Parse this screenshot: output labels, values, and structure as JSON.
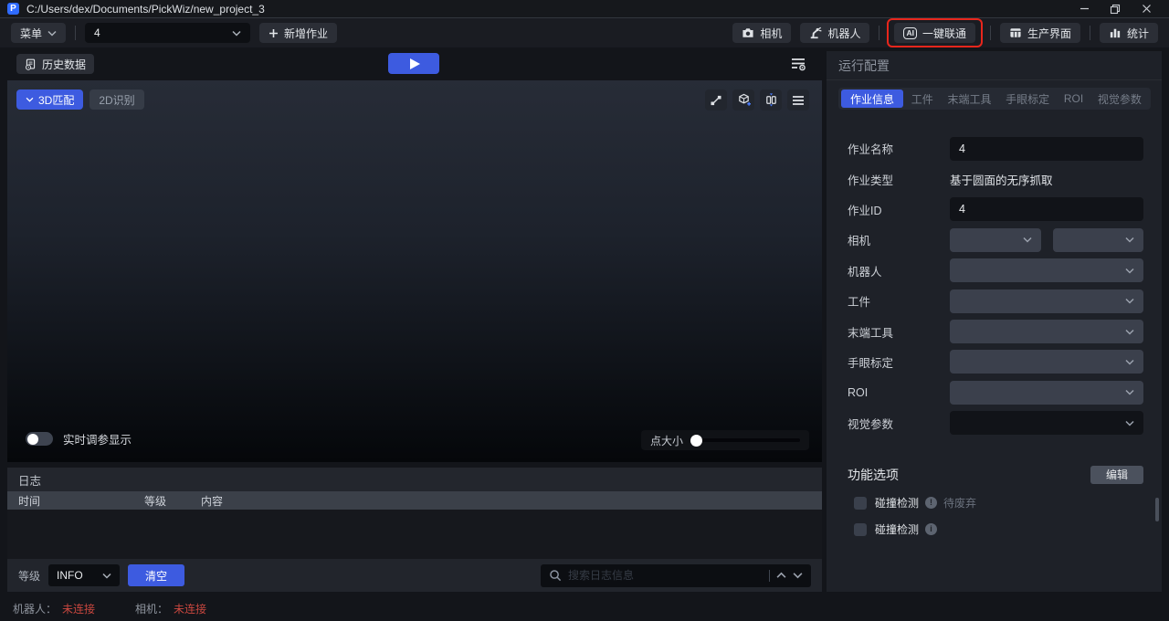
{
  "window": {
    "title": "C:/Users/dex/Documents/PickWiz/new_project_3",
    "logo_letter": "P"
  },
  "toolbar": {
    "menu": "菜单",
    "job_select": "4",
    "add_job": "新增作业",
    "camera": "相机",
    "robot": "机器人",
    "one_key": "一键联通",
    "one_key_badge": "AI",
    "production": "生产界面",
    "stats": "统计"
  },
  "workspace": {
    "history": "历史数据",
    "tab_3d_match": "3D匹配",
    "tab_2d_detect": "2D识别",
    "realtime_label": "实时调参显示",
    "point_size_label": "点大小"
  },
  "log": {
    "title": "日志",
    "columns": [
      "时间",
      "等级",
      "内容"
    ],
    "rows": [],
    "level_label": "等级",
    "level_value": "INFO",
    "clear": "清空",
    "search_placeholder": "搜索日志信息"
  },
  "config": {
    "title": "运行配置",
    "tabs": [
      {
        "label": "作业信息",
        "active": true
      },
      {
        "label": "工件",
        "active": false
      },
      {
        "label": "末端工具",
        "active": false
      },
      {
        "label": "手眼标定",
        "active": false
      },
      {
        "label": "ROI",
        "active": false
      },
      {
        "label": "视觉参数",
        "active": false
      }
    ],
    "fields": [
      {
        "label": "作业名称",
        "type": "input",
        "value": "4"
      },
      {
        "label": "作业类型",
        "type": "static",
        "value": "基于圆面的无序抓取"
      },
      {
        "label": "作业ID",
        "type": "input",
        "value": "4"
      },
      {
        "label": "相机",
        "type": "select-pair",
        "value": ""
      },
      {
        "label": "机器人",
        "type": "select",
        "value": ""
      },
      {
        "label": "工件",
        "type": "select",
        "value": ""
      },
      {
        "label": "末端工具",
        "type": "select",
        "value": ""
      },
      {
        "label": "手眼标定",
        "type": "select",
        "value": ""
      },
      {
        "label": "ROI",
        "type": "select",
        "value": ""
      },
      {
        "label": "视觉参数",
        "type": "select",
        "value": ""
      }
    ],
    "options": {
      "title": "功能选项",
      "edit": "编辑",
      "items": [
        {
          "label": "碰撞检测",
          "badge": "!",
          "note": "待废弃",
          "checked": false
        },
        {
          "label": "碰撞检测",
          "badge": "i",
          "note": "",
          "checked": false
        }
      ]
    }
  },
  "statusbar": {
    "robot_label": "机器人：",
    "robot_value": "未连接",
    "camera_label": "相机：",
    "camera_value": "未连接"
  },
  "colors": {
    "accent": "#3D5BE0",
    "danger": "#C9473F",
    "annotation": "#E8261C"
  }
}
